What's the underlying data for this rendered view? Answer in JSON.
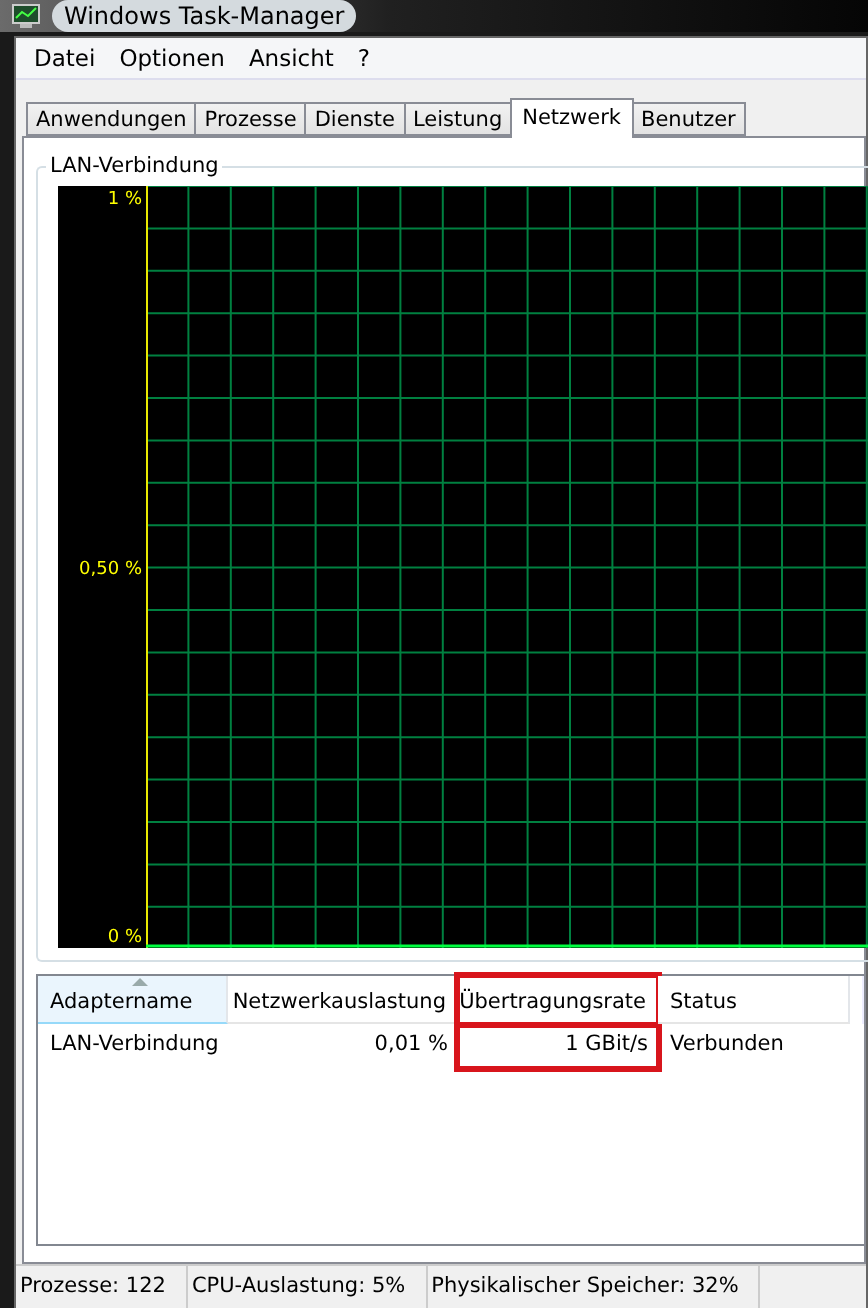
{
  "window": {
    "title": "Windows Task-Manager"
  },
  "menu": [
    "Datei",
    "Optionen",
    "Ansicht",
    "?"
  ],
  "tabs": [
    {
      "label": "Anwendungen",
      "selected": false
    },
    {
      "label": "Prozesse",
      "selected": false
    },
    {
      "label": "Dienste",
      "selected": false
    },
    {
      "label": "Leistung",
      "selected": false
    },
    {
      "label": "Netzwerk",
      "selected": true
    },
    {
      "label": "Benutzer",
      "selected": false
    }
  ],
  "graph": {
    "title": "LAN-Verbindung",
    "y_labels": [
      "1 %",
      "0,50 %",
      "0 %"
    ]
  },
  "table": {
    "columns": [
      {
        "label": "Adaptername",
        "sorted": true,
        "highlighted": false
      },
      {
        "label": "Netzwerkauslastung",
        "sorted": false,
        "highlighted": false
      },
      {
        "label": "Übertragungsrate",
        "sorted": false,
        "highlighted": true
      },
      {
        "label": "Status",
        "sorted": false,
        "highlighted": false
      }
    ],
    "rows": [
      [
        "LAN-Verbindung",
        "0,01 %",
        "1 GBit/s",
        "Verbunden"
      ]
    ]
  },
  "status_bar": [
    "Prozesse: 122",
    "CPU-Auslastung: 5%",
    "Physikalischer Speicher: 32%"
  ]
}
